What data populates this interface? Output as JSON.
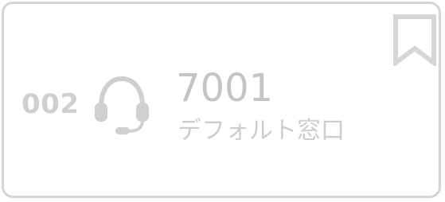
{
  "card": {
    "index": "002",
    "number": "7001",
    "name": "デフォルト窓口",
    "icons": {
      "main": "headset-icon",
      "corner": "bookmark-icon"
    },
    "colors": {
      "border": "#d4d4d4",
      "text_muted": "#c4c4c4",
      "icon": "#d0d0d0"
    }
  }
}
